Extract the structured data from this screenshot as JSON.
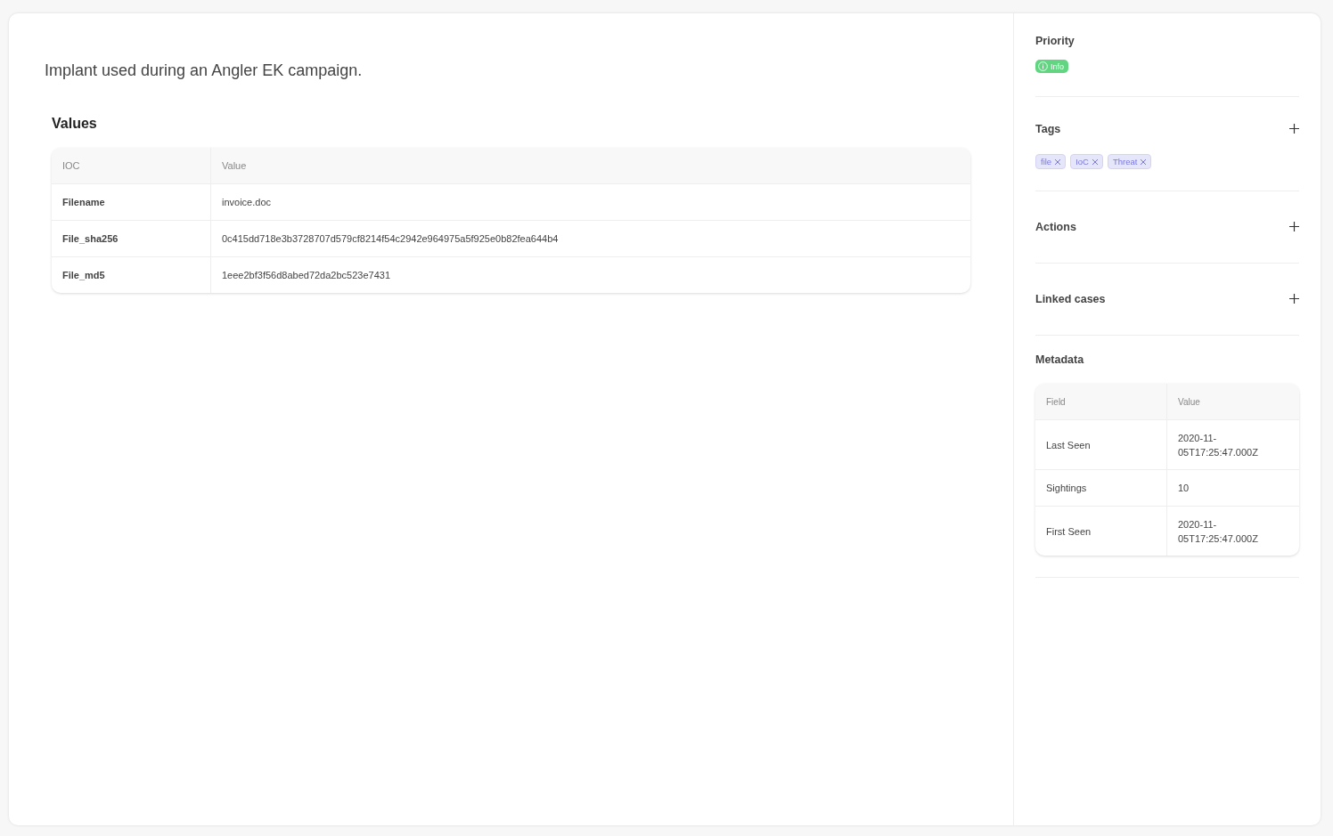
{
  "description": "Implant used during an Angler EK campaign.",
  "values": {
    "title": "Values",
    "columns": [
      "IOC",
      "Value"
    ],
    "rows": [
      {
        "ioc": "Filename",
        "value": "invoice.doc"
      },
      {
        "ioc": "File_sha256",
        "value": "0c415dd718e3b3728707d579cf8214f54c2942e964975a5f925e0b82fea644b4"
      },
      {
        "ioc": "File_md5",
        "value": "1eee2bf3f56d8abed72da2bc523e7431"
      }
    ]
  },
  "sidebar": {
    "priority": {
      "title": "Priority",
      "badge": "Info"
    },
    "tags": {
      "title": "Tags",
      "items": [
        "file",
        "IoC",
        "Threat"
      ]
    },
    "sections": [
      "Actions",
      "Linked cases"
    ],
    "metadata": {
      "title": "Metadata",
      "columns": [
        "Field",
        "Value"
      ],
      "rows": [
        {
          "field": "Last Seen",
          "value": "2020-11-05T17:25:47.000Z"
        },
        {
          "field": "Sightings",
          "value": "10"
        },
        {
          "field": "First Seen",
          "value": "2020-11-05T17:25:47.000Z"
        }
      ]
    }
  }
}
